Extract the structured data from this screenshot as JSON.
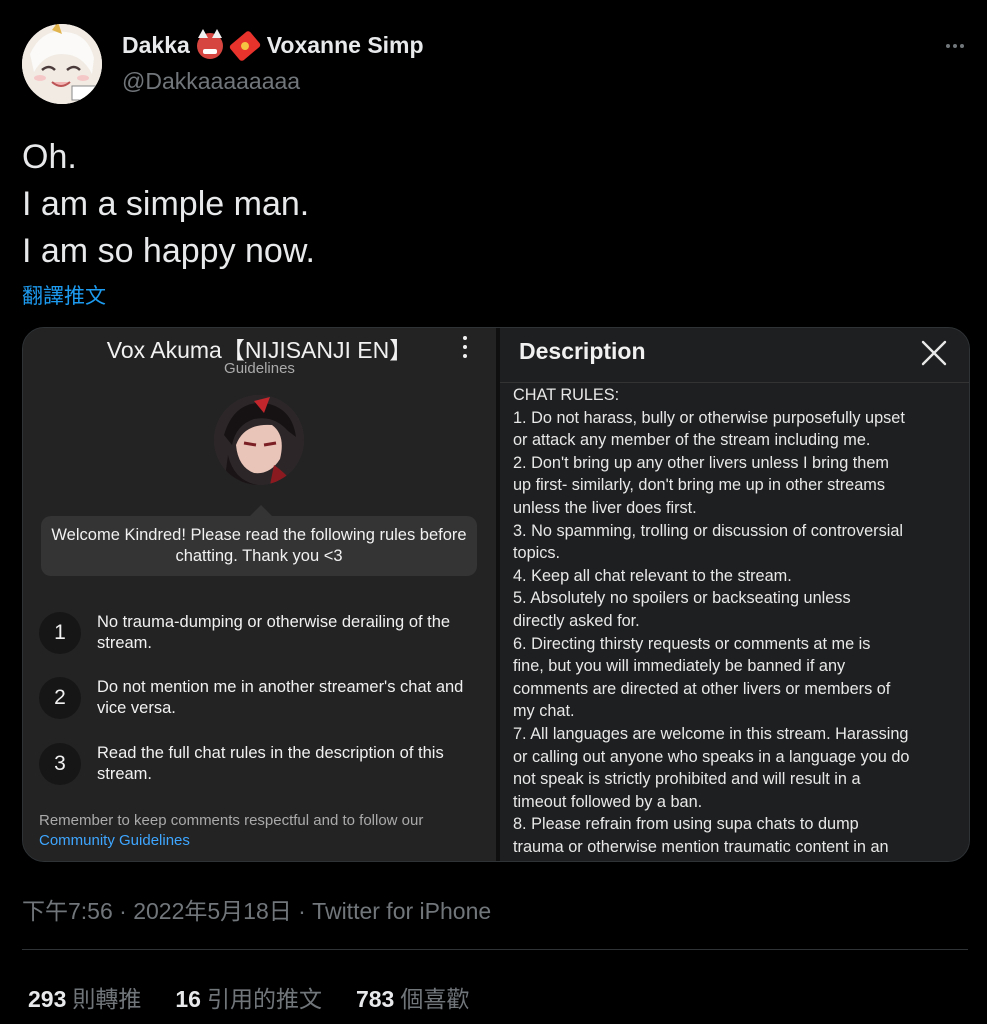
{
  "user": {
    "display_name": "Dakka",
    "display_name_suffix": "Voxanne Simp",
    "handle": "@Dakkaaaaaaaa",
    "avatar_icon": "anime-avatar-icon",
    "name_emojis": [
      "oni-mask-icon",
      "red-envelope-icon"
    ]
  },
  "tweet": {
    "lines": [
      "Oh.",
      "I am a simple man.",
      "I am so happy now."
    ],
    "translate_label": "翻譯推文"
  },
  "media": {
    "guidelines": {
      "channel_title": "Vox Akuma【NIJISANJI EN】",
      "subtitle": "Guidelines",
      "welcome": "Welcome Kindred! Please read the following rules before chatting. Thank you <3",
      "rules": [
        {
          "num": "1",
          "text": "No trauma-dumping or otherwise derailing of the stream."
        },
        {
          "num": "2",
          "text": "Do not mention me in another streamer's chat and vice versa."
        },
        {
          "num": "3",
          "text": "Read the full chat rules in the description of this stream."
        }
      ],
      "footer_text": "Remember to keep comments respectful and to follow our",
      "footer_link": "Community Guidelines"
    },
    "description": {
      "title": "Description",
      "lines": [
        "CHAT RULES:",
        "1. Do not harass, bully or otherwise purposefully upset",
        "or attack any member of the stream including me.",
        "2. Don't bring up any other livers unless I bring them",
        "up first- similarly, don't bring me up in other streams",
        "unless the liver does first.",
        "3. No spamming, trolling or discussion of controversial",
        "topics.",
        "4. Keep all chat relevant to the stream.",
        "5. Absolutely no spoilers or backseating unless",
        "directly asked for.",
        "6. Directing thirsty requests or comments at me is",
        "fine, but you will immediately be banned if any",
        "comments are directed at other livers or members of",
        "my chat.",
        "7. All languages are welcome in this stream. Harassing",
        "or calling out anyone who speaks in a language you do",
        "not speak is strictly prohibited and will result in a",
        "timeout followed by a ban.",
        "8. Please refrain from using supa chats to dump",
        "trauma or otherwise mention traumatic content in an"
      ]
    }
  },
  "meta": {
    "timestamp": "下午7:56 · 2022年5月18日 · Twitter for iPhone"
  },
  "stats": [
    {
      "value": "293",
      "label": "則轉推"
    },
    {
      "value": "16",
      "label": "引用的推文"
    },
    {
      "value": "783",
      "label": "個喜歡"
    }
  ]
}
